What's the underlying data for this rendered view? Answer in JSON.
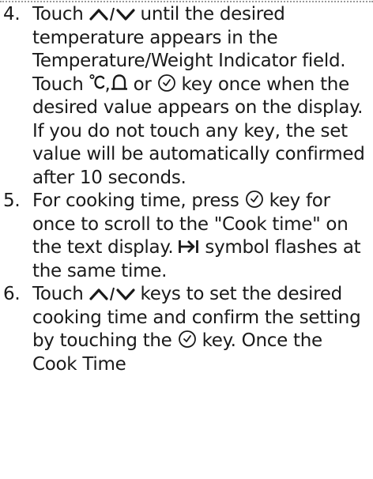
{
  "steps": [
    {
      "number": "4.",
      "t1": "Touch",
      "t2": "until the desired temperature appears in the Temperature/Weight Indicator field. Touch",
      "t3": "or",
      "t4": "key once when the desired value appears on the display. If you do not touch any key, the set value will be automatically confirmed after 10 seconds."
    },
    {
      "number": "5.",
      "t1": "For cooking time, press",
      "t2": "key for once to scroll to the \"Cook time\" on the text display.",
      "t3": "symbol flashes at the same time."
    },
    {
      "number": "6.",
      "t1": "Touch",
      "t2": "keys to set the desired cooking time and confirm the setting by touching the",
      "t3": "key. Once the Cook Time"
    }
  ],
  "icons": {
    "up_down_arrows": "up-down-arrows-icon",
    "temperature": "temperature-celsius-icon",
    "bell": "bell-icon",
    "clock": "clock-icon",
    "end_time": "end-time-arrow-icon"
  }
}
